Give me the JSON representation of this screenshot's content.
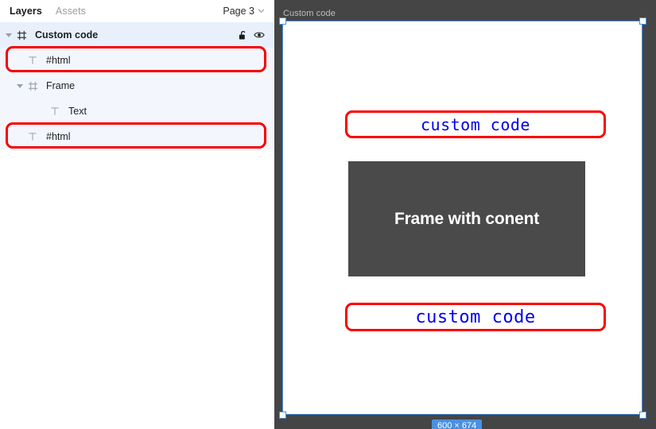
{
  "left_panel": {
    "tabs": [
      {
        "label": "Layers",
        "active": true
      },
      {
        "label": "Assets",
        "active": false
      }
    ],
    "page_selector": {
      "label": "Page 3",
      "icon": "chevron-down-icon"
    },
    "layers": [
      {
        "label": "Custom code",
        "icon": "frame-icon",
        "indent": 0,
        "selected": true,
        "has_disclosure": true,
        "disclosure_open": true,
        "annotated": false,
        "actions": [
          "unlock-icon",
          "eye-icon"
        ]
      },
      {
        "label": "#html",
        "icon": "text-icon",
        "indent": 1,
        "selected": false,
        "has_disclosure": false,
        "disclosure_open": false,
        "annotated": true,
        "actions": []
      },
      {
        "label": "Frame",
        "icon": "frame-icon",
        "indent": 1,
        "selected": false,
        "has_disclosure": true,
        "disclosure_open": true,
        "annotated": false,
        "actions": []
      },
      {
        "label": "Text",
        "icon": "text-icon",
        "indent": 2,
        "selected": false,
        "has_disclosure": false,
        "disclosure_open": false,
        "annotated": false,
        "actions": []
      },
      {
        "label": "#html",
        "icon": "text-icon",
        "indent": 1,
        "selected": false,
        "has_disclosure": false,
        "disclosure_open": false,
        "annotated": true,
        "actions": []
      }
    ]
  },
  "canvas": {
    "frame_label": "Custom code",
    "dimension_badge": "600 × 674",
    "elements": {
      "code_top": "custom code",
      "inner_frame_text": "Frame with conent",
      "code_bottom": "custom code"
    }
  },
  "colors": {
    "annotation_red": "#fc0000",
    "code_blue": "#0000f0",
    "selection_blue": "#4a90e2",
    "canvas_bg": "#454545",
    "inner_frame_bg": "#4a4a4a",
    "row_bg": "#f3f6fd",
    "row_selected_bg": "#e8f0fc"
  }
}
